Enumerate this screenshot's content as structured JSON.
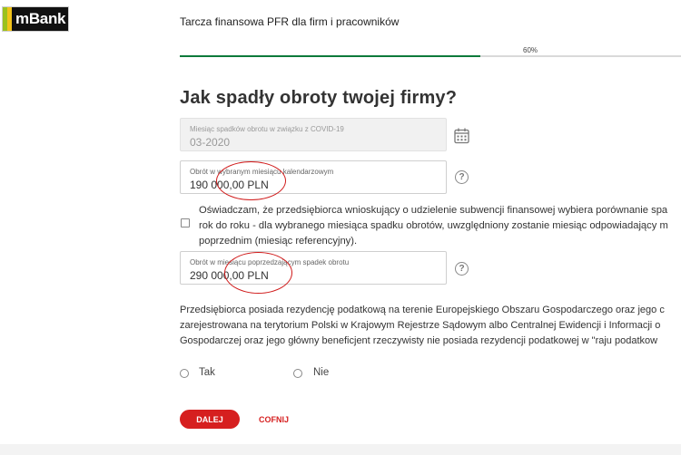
{
  "brand": {
    "logo_text": "mBank",
    "colors": {
      "stripe_green": "#9bc11f",
      "stripe_yellow": "#f2c31b",
      "logo_bg": "#111111",
      "accent_red": "#d61f1f",
      "progress_green": "#0b7a3a"
    }
  },
  "header": {
    "title": "Tarcza finansowa PFR dla firm i pracowników"
  },
  "progress": {
    "label": "60%",
    "value": 0.6
  },
  "page": {
    "title": "Jak spadły obroty twojej firmy?"
  },
  "fields": {
    "month": {
      "label": "Miesiąc spadków obrotu w związku z COVID-19",
      "value": "03-2020",
      "icon": "calendar-icon"
    },
    "turnover_selected": {
      "label": "Obrót w wybranym miesiącu kalendarzowym",
      "value": "190 000,00 PLN",
      "icon": "help-icon"
    },
    "turnover_previous": {
      "label": "Obrót w miesiącu poprzedzającym spadek obrotu",
      "value": "290 000,00 PLN",
      "icon": "help-icon"
    }
  },
  "consent": {
    "lines": [
      "Oświadczam, że przedsiębiorca wnioskujący o udzielenie subwencji finansowej wybiera porównanie spa",
      "rok do roku - dla wybranego miesiąca spadku obrotów, uwzględniony zostanie miesiąc odpowiadający m",
      "poprzednim (miesiąc referencyjny)."
    ]
  },
  "residency": {
    "lines": [
      "Przedsiębiorca posiada rezydencję podatkową na terenie Europejskiego Obszaru Gospodarczego oraz jego c",
      "zarejestrowana na terytorium Polski w Krajowym Rejestrze Sądowym albo Centralnej Ewidencji i Informacji o",
      "Gospodarczej oraz jego główny beneficjent rzeczywisty nie posiada rezydencji podatkowej w \"raju podatkow"
    ],
    "options": [
      "Tak",
      "Nie"
    ]
  },
  "actions": {
    "next_label": "DALEJ",
    "back_label": "COFNIJ"
  }
}
